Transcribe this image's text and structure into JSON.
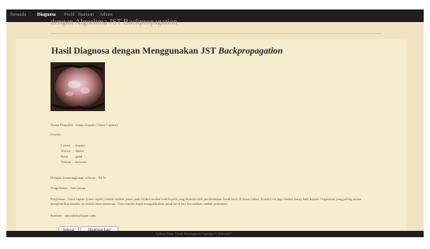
{
  "nav": {
    "items": [
      "Beranda",
      "Diagnosa",
      "Profil",
      "Bantuan",
      "Admin"
    ],
    "active_index": 1
  },
  "header": {
    "subtitle": "dengan Algoritma JST Backpropagation"
  },
  "result": {
    "title_prefix": "Hasil Diagnosa dengan Menggunakan JST ",
    "title_emphasis": "Backpropagation",
    "disease_line": "Nama Penyakit : Jamur kepala (Tinea Capitis)",
    "gejala_heading": "Gejala :",
    "gejala": [
      {
        "label": "Lokasi",
        "value": "kepala"
      },
      {
        "label": "Warna",
        "value": "hitam"
      },
      {
        "label": "Rasa",
        "value": "gatal"
      },
      {
        "label": "Tekstur",
        "value": "bersisik"
      }
    ],
    "accuracy_line": "Dengan keemungkinan sebesar : 93 %",
    "treatment_line": "Pengobatan : Anti jamur",
    "explanation": "Penjelasan : Tinea kapitis (tinea capitis) adalah infeksi jamur pada folikel rambut kulit kepala yang ditandai oleh pembentukan kerak kecil di dasar folikel. Kondisi ini juga disebut kurap kulit kepala. Organisme yang paling umum menghasilkan kondisi ini adalah tinea tonsurans. Tinea kapitis dapat mengakibatkan petak kecil dari kerontokan rambut permanen.",
    "source": "Sumber : tanyadoksehatan.com"
  },
  "buttons": {
    "finish": "Selesai",
    "again": "Diagnosa Lagi"
  },
  "footer": {
    "text": "Aplikasi Pakar Untuk Mendiagnosa Copyright © 2016-2017 ..."
  }
}
